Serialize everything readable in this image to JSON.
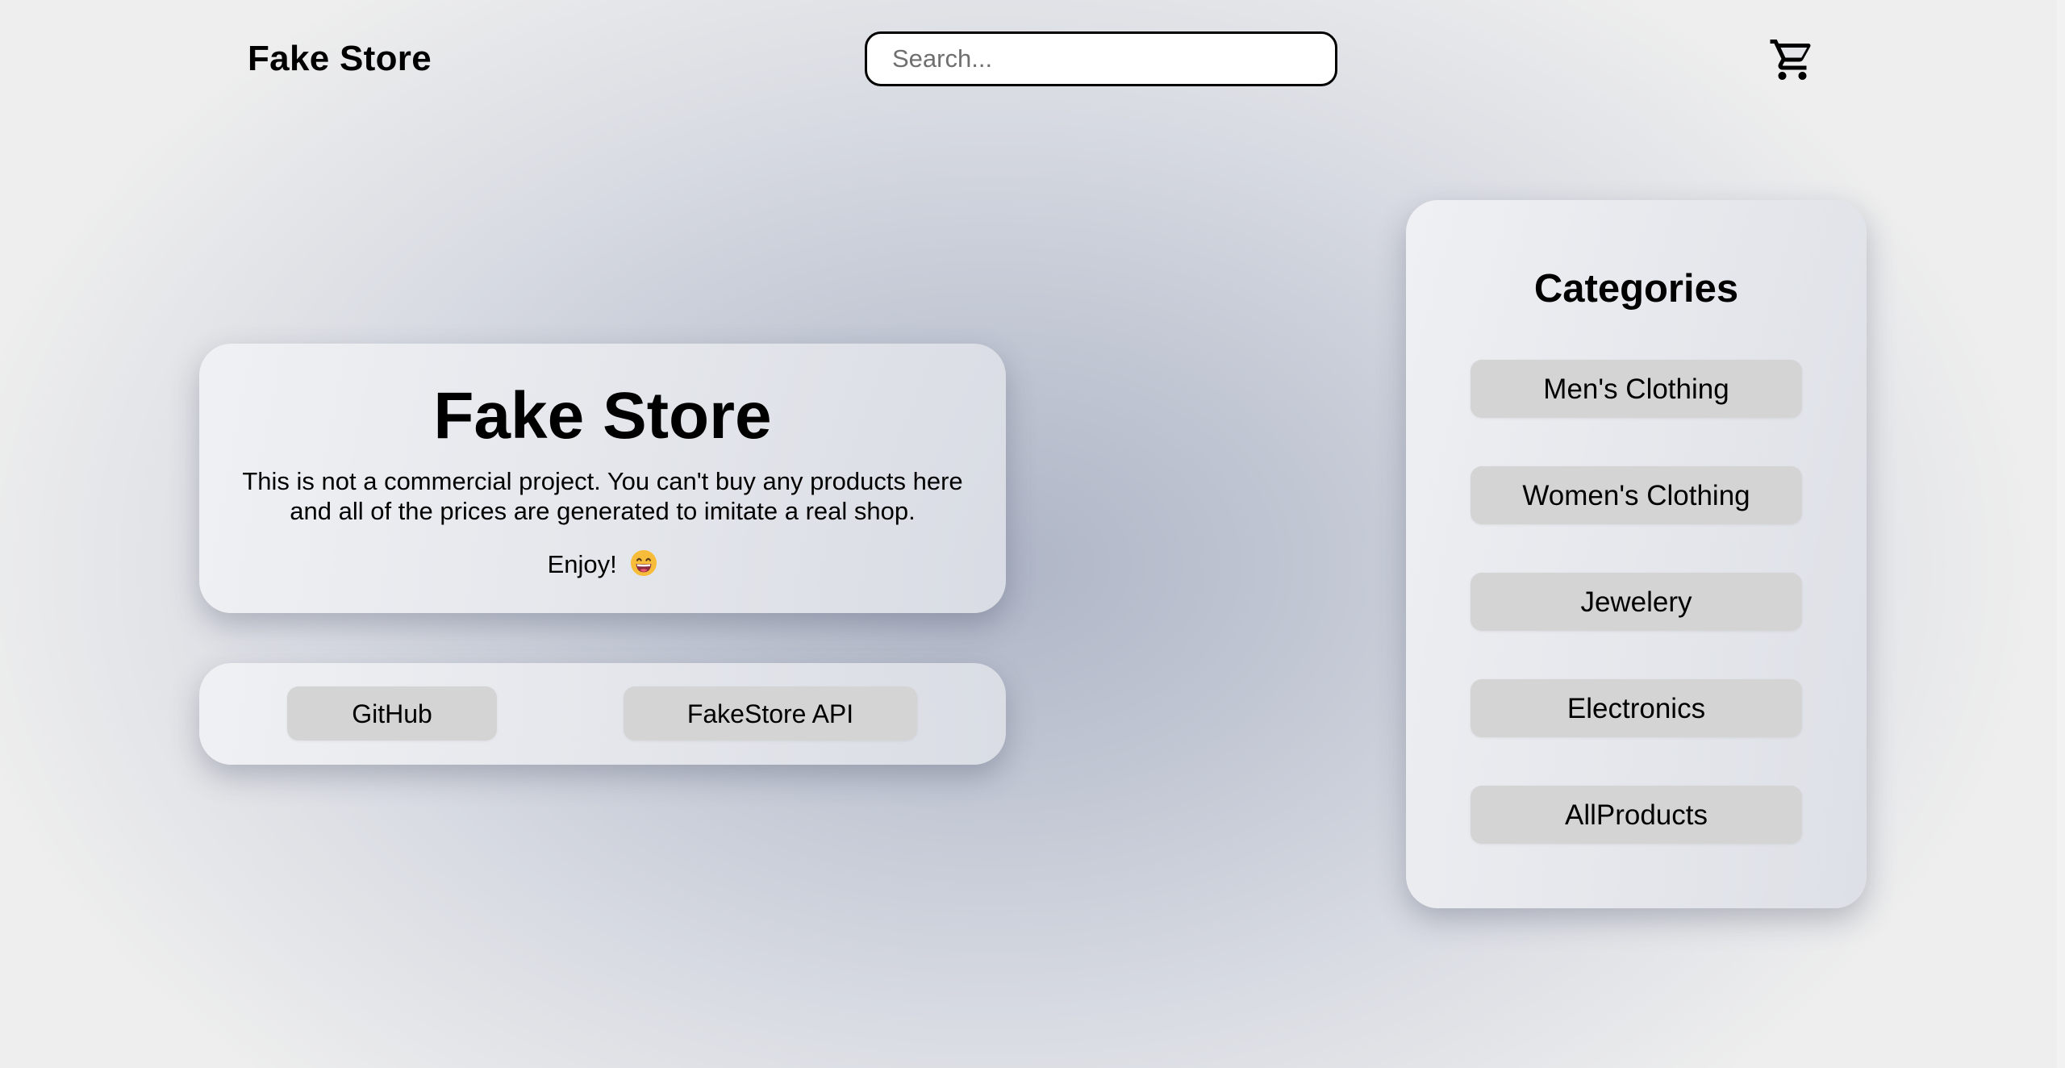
{
  "header": {
    "brand": "Fake Store",
    "search_placeholder": "Search...",
    "cart_icon": "shopping-cart-icon"
  },
  "intro": {
    "title": "Fake Store",
    "description": "This is not a commercial project. You can't buy any products here and all of the prices are generated to imitate a real shop.",
    "enjoy": "Enjoy!",
    "emoji_icon": "grinning-face-emoji-icon"
  },
  "links": {
    "github": "GitHub",
    "api": "FakeStore API"
  },
  "categories": {
    "title": "Categories",
    "items": [
      {
        "label": "Men's Clothing"
      },
      {
        "label": "Women's Clothing"
      },
      {
        "label": "Jewelery"
      },
      {
        "label": "Electronics"
      },
      {
        "label": "AllProducts"
      }
    ]
  },
  "colors": {
    "button_bg": "#d4d4d4",
    "panel_bg": "#e8e9ed",
    "text": "#000000"
  }
}
